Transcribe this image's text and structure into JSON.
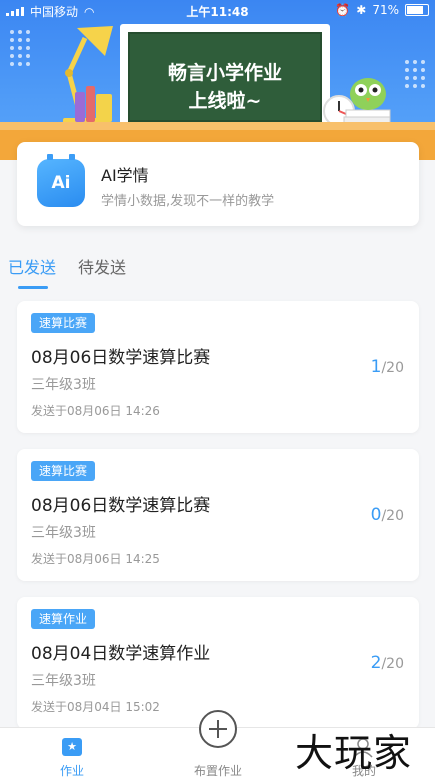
{
  "status_bar": {
    "carrier": "中国移动",
    "time": "上午11:48",
    "battery": "71%"
  },
  "banner": {
    "line1": "畅言小学作业",
    "line2": "上线啦~"
  },
  "ai_card": {
    "icon_text": "Ai",
    "title": "AI学情",
    "subtitle": "学情小数据,发现不一样的教学"
  },
  "tabs": [
    {
      "label": "已发送",
      "active": true
    },
    {
      "label": "待发送",
      "active": false
    }
  ],
  "tasks": [
    {
      "badge": "速算比赛",
      "title": "08月06日数学速算比赛",
      "class": "三年级3班",
      "time": "发送于08月06日 14:26",
      "done": "1",
      "total": "/20"
    },
    {
      "badge": "速算比赛",
      "title": "08月06日数学速算比赛",
      "class": "三年级3班",
      "time": "发送于08月06日 14:25",
      "done": "0",
      "total": "/20"
    },
    {
      "badge": "速算作业",
      "title": "08月04日数学速算作业",
      "class": "三年级3班",
      "time": "发送于08月04日 15:02",
      "done": "2",
      "total": "/20"
    }
  ],
  "bottom_nav": {
    "homework_label": "作业",
    "assign_label": "布置作业",
    "me_label": "我的",
    "home_icon_glyph": "★"
  },
  "watermark": "大玩家",
  "colors": {
    "accent": "#3a9cf5",
    "banner_blue": "#3b86f2",
    "board_green": "#2f5d3a",
    "floor_orange": "#f3a73a"
  }
}
